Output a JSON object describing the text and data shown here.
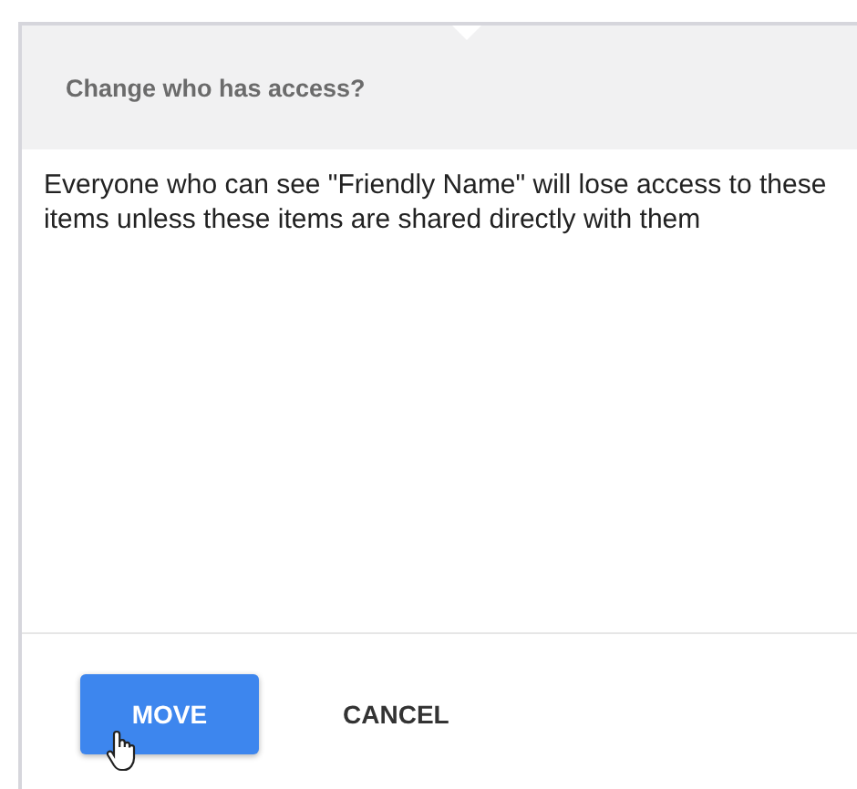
{
  "dialog": {
    "title": "Change who has access?",
    "message": "Everyone who can see \"Friendly Name\" will lose access to these items unless these items are shared directly with them",
    "buttons": [
      {
        "label": "MOVE",
        "kind": "primary",
        "hovered": true
      },
      {
        "label": "CANCEL",
        "kind": "text",
        "hovered": false
      }
    ]
  }
}
